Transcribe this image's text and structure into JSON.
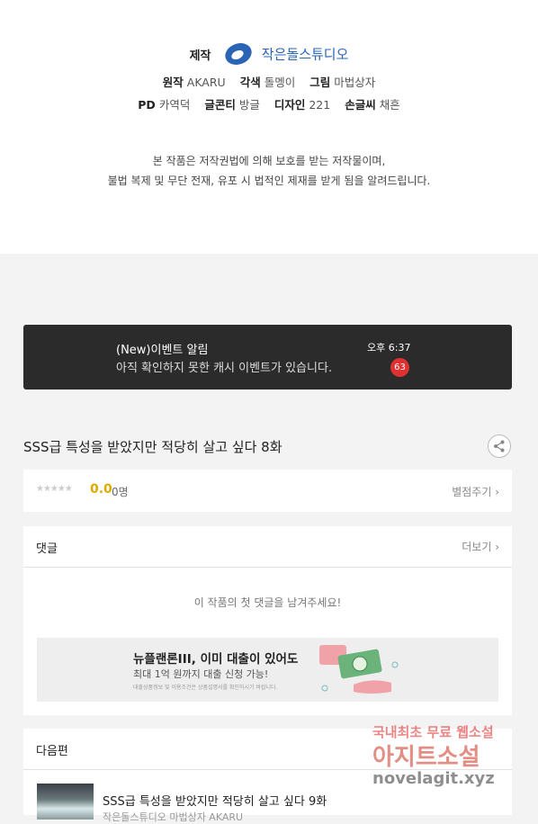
{
  "credits": {
    "production_label": "제작",
    "studio_name": "작은돌스튜디오",
    "original_label": "원작",
    "original_value": "AKARU",
    "adaptation_label": "각색",
    "adaptation_value": "돌멩이",
    "art_label": "그림",
    "art_value": "마법상자",
    "pd_label": "PD",
    "pd_value": "카역덕",
    "lettering_label": "글콘티",
    "lettering_value": "방글",
    "design_label": "디자인",
    "design_value": "221",
    "handwriting_label": "손글씨",
    "handwriting_value": "채흔"
  },
  "notice": {
    "line1": "본 작품은 저작권법에 의해 보호를 받는 저작물이며,",
    "line2": "불법 복제 및 무단 전재, 유포 시 법적인 제재를 받게 됨을 알려드립니다."
  },
  "banner": {
    "title": "(New)이벤트 알림",
    "text": "아직 확인하지 못한 캐시 이벤트가 있습니다.",
    "time": "오후 6:37",
    "badge": "63"
  },
  "episode": {
    "title": "SSS급 특성을 받았지만 적당히 살고 싶다 8화",
    "share_icon": "share-icon"
  },
  "rating": {
    "stars": "★★★★★",
    "score": "0.0",
    "count": "0명",
    "rate_link": "별점주기 ›"
  },
  "comments": {
    "heading": "댓글",
    "more": "더보기 ›",
    "empty": "이 작품의 첫 댓글을 남겨주세요!"
  },
  "ad": {
    "title": "뉴플랜론III, 이미 대출이 있어도",
    "subtitle": "최대 1억 원까지 대출 신청 가능!",
    "fine_print": "대출상품정보 및 이용조건은 상품설명서를 확인하시기 바랍니다."
  },
  "next_episode": {
    "heading": "다음편",
    "title": "SSS급 특성을 받았지만 적당히 살고 싶다 9화",
    "subtitle": "작은돌스튜디오 마법상자 AKARU"
  },
  "watermark": {
    "line1": "국내최초 무료 웹소설",
    "line2": "아지트소설",
    "line3": "novelagit.xyz"
  },
  "colors": {
    "studio_blue": "#2a64b5",
    "banner_bg": "#2b2b2b",
    "badge_red": "#e03131",
    "score_gold": "#e0a800"
  }
}
